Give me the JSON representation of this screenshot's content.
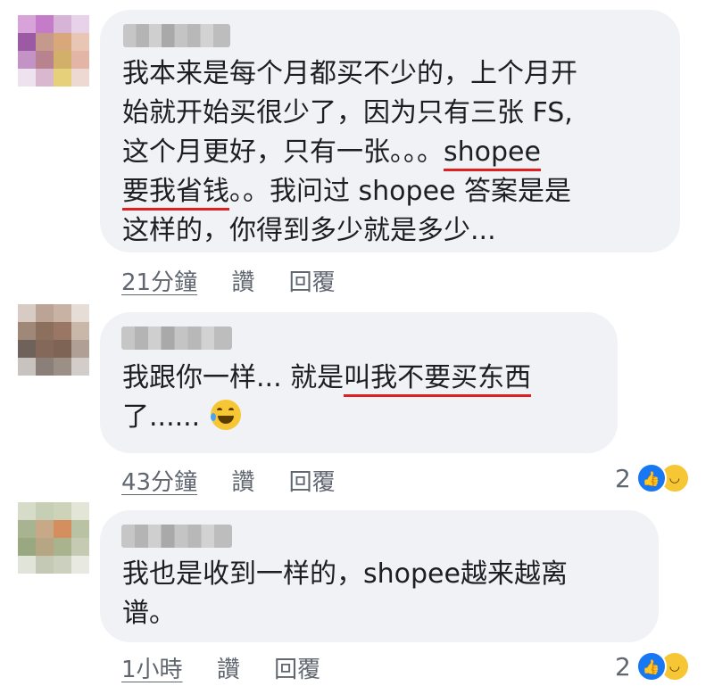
{
  "comments": [
    {
      "lines": [
        [
          {
            "t": "我本来是每个月都买不少的，上个月开"
          }
        ],
        [
          {
            "t": "始就开始买很少了，因为只有三张 FS,"
          }
        ],
        [
          {
            "t": "这个月更好，只有一张。。。"
          },
          {
            "t": "shopee",
            "u": true
          }
        ],
        [
          {
            "t": "要我省钱",
            "u": true
          },
          {
            "t": "。。我问过 shopee 答案是是"
          }
        ],
        [
          {
            "t": "这样的，你得到多少就是多少..."
          }
        ]
      ],
      "time": "21分鐘",
      "like": "讚",
      "reply": "回覆"
    },
    {
      "lines": [
        [
          {
            "t": "我跟你一样... 就是"
          },
          {
            "t": "叫我不要买东西",
            "u": true
          }
        ],
        [
          {
            "t": "了......"
          }
        ]
      ],
      "emoji": "grinning-squinting-tears-emoji",
      "time": "43分鐘",
      "like": "讚",
      "reply": "回覆",
      "reactions": {
        "count": "2",
        "icons": [
          "like-icon",
          "haha-icon"
        ]
      }
    },
    {
      "lines": [
        [
          {
            "t": "我也是收到一样的，shopee越来越离"
          }
        ],
        [
          {
            "t": "谱。"
          }
        ]
      ],
      "time": "1小時",
      "like": "讚",
      "reply": "回覆",
      "reactions": {
        "count": "2",
        "icons": [
          "like-icon",
          "haha-icon"
        ]
      }
    }
  ],
  "colors": {
    "bubble": "#f0f2f5",
    "text": "#1c1e21",
    "meta": "#606770",
    "underline": "#e02020",
    "like": "#1877f2",
    "haha": "#f7c634"
  }
}
